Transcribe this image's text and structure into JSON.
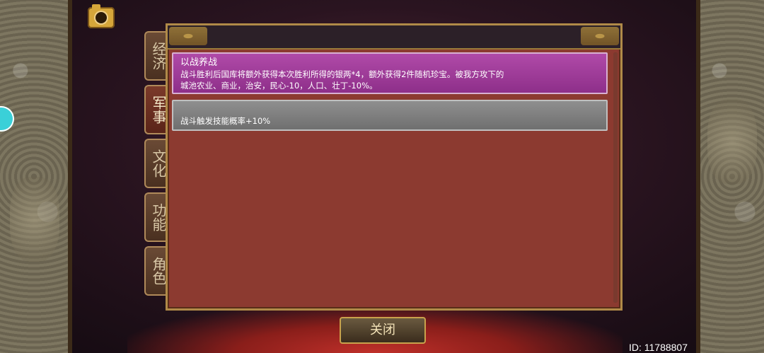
{
  "tabs": [
    {
      "label": "经济"
    },
    {
      "label": "军事"
    },
    {
      "label": "文化"
    },
    {
      "label": "功能"
    },
    {
      "label": "角色"
    }
  ],
  "active_tab": "军事",
  "items": [
    {
      "title": "以战养战",
      "description_line1": "战斗胜利后国库将额外获得本次胜利所得的银两*4，额外获得2件随机珍宝。被我方攻下的",
      "description_line2": "城池农业、商业，治安，民心-10，人口、壮丁-10%。",
      "color": "#9e3c9a"
    },
    {
      "title": "",
      "description_line1": "战斗触发技能概率+10%",
      "color": "#808080"
    }
  ],
  "close_label": "关闭",
  "id_label": "ID: 11788807",
  "icons": {
    "camera": "camera-icon"
  }
}
